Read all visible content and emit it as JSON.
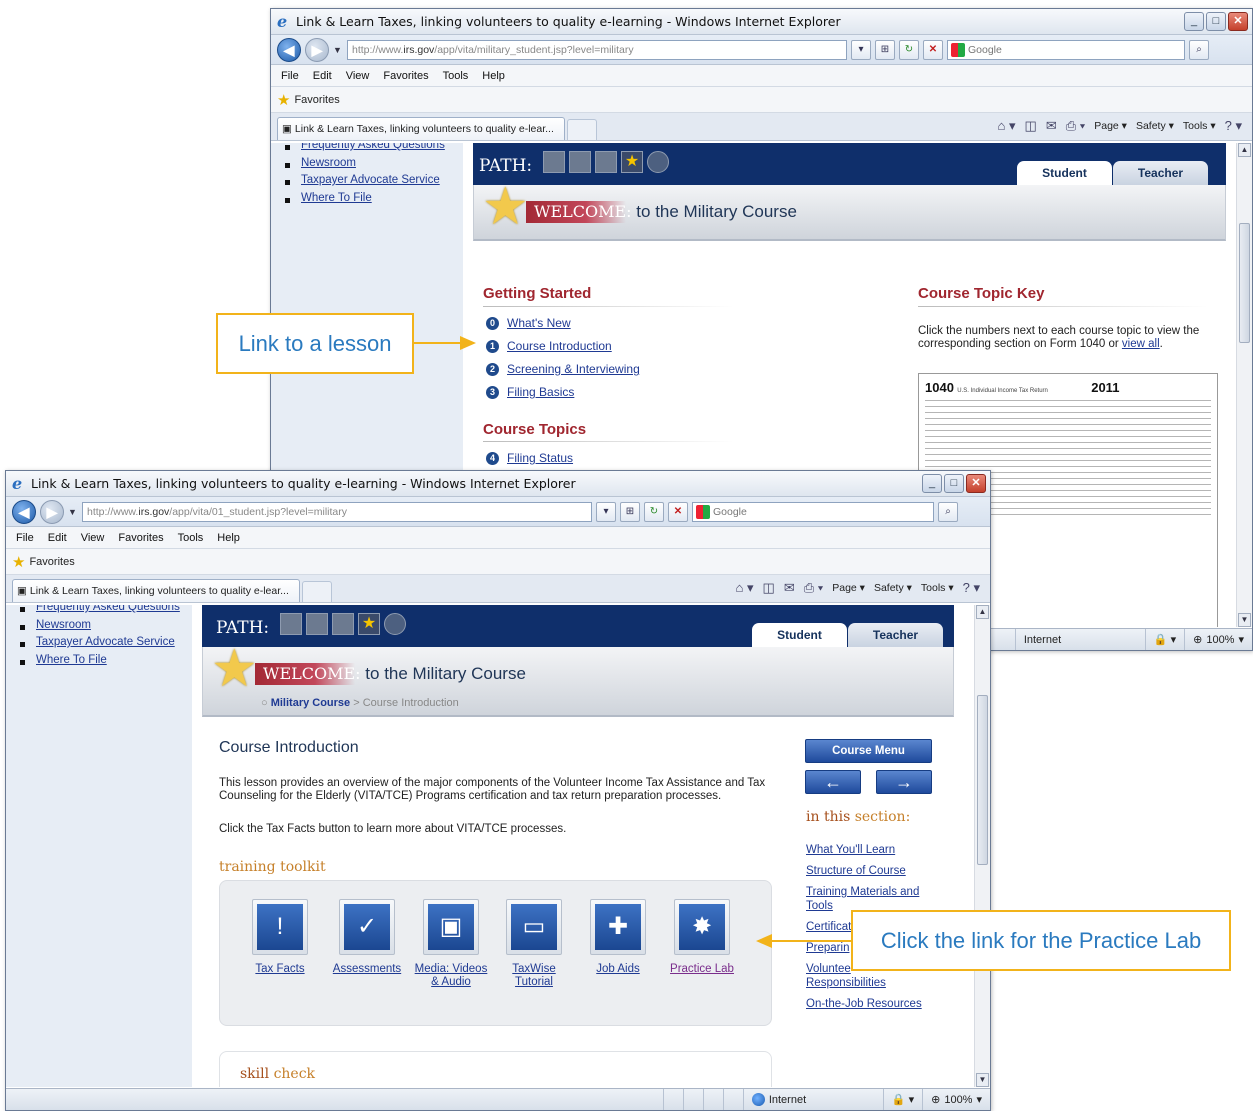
{
  "window1": {
    "title": "Link & Learn Taxes, linking volunteers to quality e-learning - Windows Internet Explorer",
    "url_prefix": "http://www.",
    "url_host": "irs.gov",
    "url_path": "/app/vita/military_student.jsp?level=military",
    "search_placeholder": "Google",
    "menu": [
      "File",
      "Edit",
      "View",
      "Favorites",
      "Tools",
      "Help"
    ],
    "favorites_label": "Favorites",
    "tab_label": "Link & Learn Taxes, linking volunteers to quality e-lear...",
    "cmd": {
      "page": "Page ▾",
      "safety": "Safety ▾",
      "tools": "Tools ▾"
    },
    "left_nav": [
      "Frequently Asked Questions",
      "Newsroom",
      "Taxpayer Advocate Service",
      "Where To File"
    ],
    "path_label": "PATH:",
    "tab_student": "Student",
    "tab_teacher": "Teacher",
    "welcome_word": "WELCOME:",
    "welcome_rest": "to the Military Course",
    "getting_started": "Getting Started",
    "lessons": [
      {
        "num": "0",
        "label": "What's New"
      },
      {
        "num": "1",
        "label": "Course Introduction"
      },
      {
        "num": "2",
        "label": "Screening & Interviewing"
      },
      {
        "num": "3",
        "label": "Filing Basics"
      }
    ],
    "course_topics": "Course Topics",
    "topics": [
      {
        "num": "4",
        "label": "Filing Status"
      }
    ],
    "topic_key_title": "Course Topic Key",
    "topic_key_text": "Click the numbers next to each course topic to view the corresponding section on Form 1040 or ",
    "topic_key_link": "view all",
    "form_title": "1040",
    "form_subtitle": "U.S. Individual Income Tax Return",
    "form_year": "2011",
    "status_zone": "Internet",
    "zoom": "100%"
  },
  "window2": {
    "title": "Link & Learn Taxes, linking volunteers to quality e-learning - Windows Internet Explorer",
    "url_prefix": "http://www.",
    "url_host": "irs.gov",
    "url_path": "/app/vita/01_student.jsp?level=military",
    "search_placeholder": "Google",
    "menu": [
      "File",
      "Edit",
      "View",
      "Favorites",
      "Tools",
      "Help"
    ],
    "favorites_label": "Favorites",
    "tab_label": "Link & Learn Taxes, linking volunteers to quality e-lear...",
    "cmd": {
      "page": "Page ▾",
      "safety": "Safety ▾",
      "tools": "Tools ▾"
    },
    "left_nav": [
      "Frequently Asked Questions",
      "Newsroom",
      "Taxpayer Advocate Service",
      "Where To File"
    ],
    "path_label": "PATH:",
    "tab_student": "Student",
    "tab_teacher": "Teacher",
    "welcome_word": "WELCOME:",
    "welcome_rest": "to the Military Course",
    "crumb_link": "Military Course",
    "crumb_rest": " > Course Introduction",
    "heading": "Course Introduction",
    "para1": "This lesson provides an overview of the major components of the Volunteer Income Tax Assistance and Tax Counseling for the Elderly (VITA/TCE) Programs certification and tax return preparation processes.",
    "para2": "Click the Tax Facts button to learn more about VITA/TCE processes.",
    "toolkit_title_a": "training",
    "toolkit_title_b": "toolkit",
    "tools": [
      {
        "label": "Tax Facts",
        "glyph": "!"
      },
      {
        "label": "Assessments",
        "glyph": "✓"
      },
      {
        "label": "Media: Videos & Audio",
        "glyph": "▣"
      },
      {
        "label": "TaxWise Tutorial",
        "glyph": "▭"
      },
      {
        "label": "Job Aids",
        "glyph": "✚"
      },
      {
        "label": "Practice Lab",
        "glyph": "✸"
      }
    ],
    "course_menu": "Course Menu",
    "prev_arrow": "←",
    "next_arrow": "→",
    "section_a": "in this",
    "section_b": "section:",
    "section_links": [
      "What You'll Learn",
      "Structure of Course",
      "Training Materials and Tools",
      "Certificat",
      "Preparin",
      "Voluntee",
      "Responsibilities",
      "On-the-Job Resources"
    ],
    "skill_a": "skill",
    "skill_b": "check",
    "status_zone": "Internet",
    "zoom": "100%"
  },
  "callouts": {
    "lesson": "Link to a lesson",
    "practice": "Click the link for the Practice Lab"
  },
  "colors": {
    "accent": "#f2b31a",
    "heading_red": "#a0262f",
    "banner": "#0f2f6b",
    "link": "#1f3a93"
  }
}
